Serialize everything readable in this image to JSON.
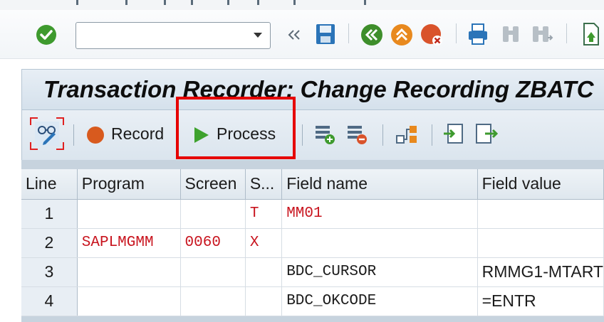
{
  "window": {
    "title": "Transaction Recorder: Change Recording ZBATC"
  },
  "system_toolbar": {
    "command_field_value": "",
    "icons": [
      "enter-icon",
      "back-double-chevron-icon",
      "save-icon",
      "back-icon",
      "exit-icon",
      "cancel-icon",
      "print-icon",
      "find-icon",
      "find-next-icon",
      "first-page-icon"
    ]
  },
  "app_toolbar": {
    "record_label": "Record",
    "process_label": "Process"
  },
  "table": {
    "columns": [
      "Line",
      "Program",
      "Screen",
      "S...",
      "Field name",
      "Field value"
    ],
    "rows": [
      {
        "line": "1",
        "program": "",
        "screen": "",
        "start": "T",
        "field_name": "MM01",
        "field_value": ""
      },
      {
        "line": "2",
        "program": "SAPLMGMM",
        "screen": "0060",
        "start": "X",
        "field_name": "",
        "field_value": ""
      },
      {
        "line": "3",
        "program": "",
        "screen": "",
        "start": "",
        "field_name": "BDC_CURSOR",
        "field_value": "RMMG1-MTART"
      },
      {
        "line": "4",
        "program": "",
        "screen": "",
        "start": "",
        "field_name": "BDC_OKCODE",
        "field_value": "=ENTR"
      }
    ]
  },
  "colors": {
    "highlight": "#e60000",
    "screen_entry_text": "#c8141e",
    "title_bar": "#dbe5ee"
  }
}
